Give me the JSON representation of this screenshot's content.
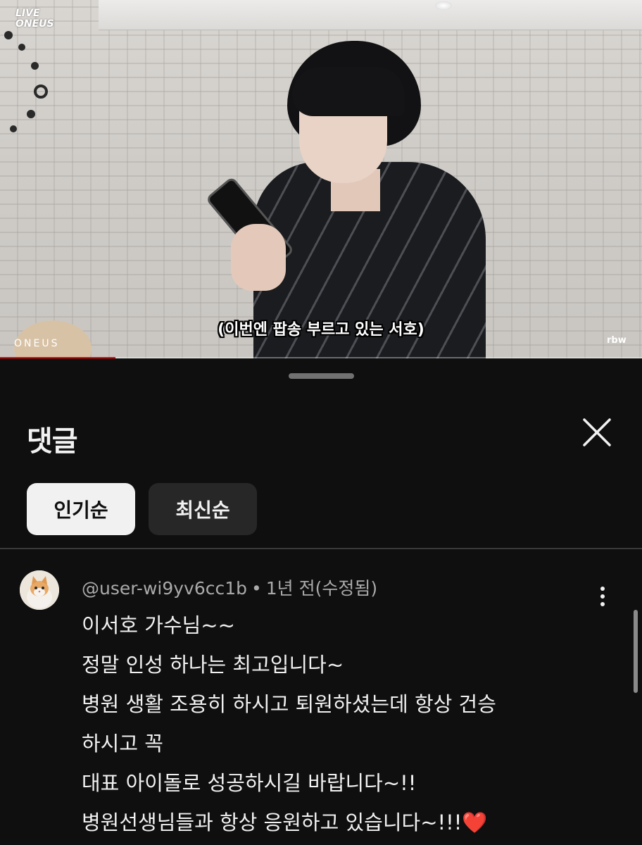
{
  "video": {
    "channel_logo_line1": "LIVE",
    "channel_logo_line2": "ONEUS",
    "subtitle": "(이번엔 팝송 부르고 있는 서호)",
    "watermark": "ONEUS",
    "corner_logo": "rbw",
    "progress": 0.18,
    "progress_color": "#ff0000"
  },
  "panel": {
    "title": "댓글",
    "close_icon": "close-icon",
    "sort_chips": [
      {
        "label": "인기순",
        "active": true
      },
      {
        "label": "최신순",
        "active": false
      }
    ]
  },
  "comment": {
    "author": "@user-wi9yv6cc1b",
    "separator": "•",
    "time": "1년 전(수정됨)",
    "lines": [
      "이서호 가수님~~",
      "정말 인성 하나는 최고입니다~",
      "병원 생활 조용히 하시고 퇴원하셨는데 항상 건승",
      "하시고 꼭",
      "대표 아이돌로 성공하시길 바랍니다~!!",
      "병원선생님들과 항상 응원하고 있습니다~!!!"
    ],
    "emoji": "❤️"
  },
  "colors": {
    "background": "#0f0f0f",
    "text": "#f1f1f1",
    "muted_text": "#aaaaaa",
    "chip_active_bg": "#f1f1f1",
    "chip_inactive_bg": "#272727"
  }
}
